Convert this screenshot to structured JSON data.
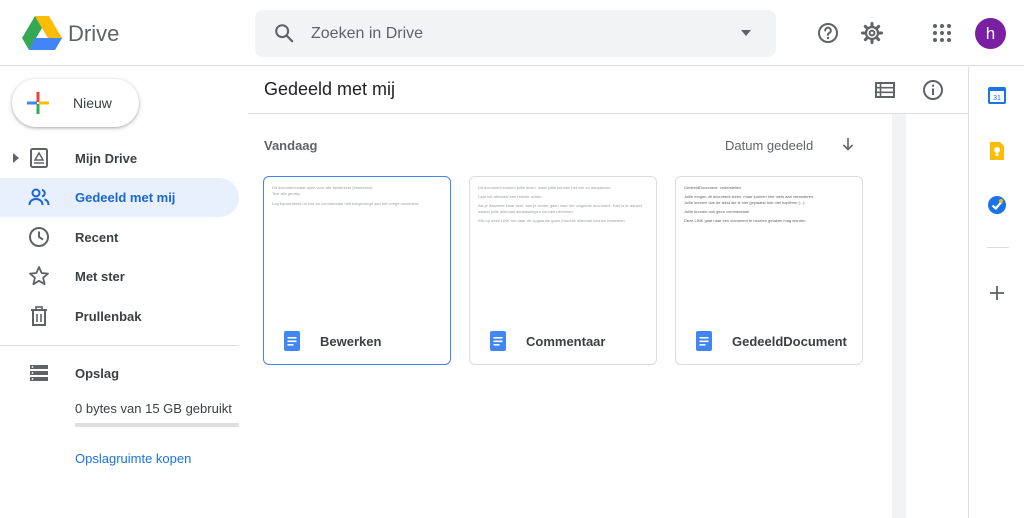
{
  "app": {
    "name": "Drive"
  },
  "search": {
    "placeholder": "Zoeken in Drive"
  },
  "header": {
    "avatar_initial": "h"
  },
  "sidebar": {
    "new_label": "Nieuw",
    "items": [
      {
        "label": "Mijn Drive",
        "icon": "drive-icon"
      },
      {
        "label": "Gedeeld met mij",
        "icon": "people-icon",
        "active": true
      },
      {
        "label": "Recent",
        "icon": "clock-icon"
      },
      {
        "label": "Met ster",
        "icon": "star-icon"
      },
      {
        "label": "Prullenbak",
        "icon": "trash-icon"
      }
    ],
    "storage": {
      "label": "Opslag",
      "used_text": "0 bytes van 15 GB gebruikt",
      "used_fraction": 0.0,
      "buy_label": "Opslagruimte kopen"
    }
  },
  "main": {
    "title": "Gedeeld met mij",
    "section": "Vandaag",
    "sort_label": "Datum gedeeld",
    "files": [
      {
        "name": "Bewerken",
        "selected": true,
        "preview": [
          "Dit document staat open voor alle bewerkers (bewerken).",
          "Test alle gevalg",
          "Log bijvoorbeeld uit hoe en commentaar helt toegevoegd aan het vorige document."
        ]
      },
      {
        "name": "Commentaar",
        "selected": false,
        "preview": [
          "Dit document kunnen jullie lezen, maar jullie kunnen het niet zo aanpassen.",
          "Laat het allemaal een reactie achter.",
          "Als je daarmee klaar bent, kan je verder gaan naar het volgende document. Dan is er aanzet waarin jullie allemaal aanpassingen kunnen uitvoeren.",
          "Klik op deze LINK om naar de opgaande gaan (bruchte allemaal kunnen bewerken."
        ]
      },
      {
        "name": "GedeeldDocument",
        "selected": false,
        "preview": [
          "GedeeldDocument: onderstellen",
          "Jullie mogen dit document lezen, maar kunnen hier niets aan veranderen.",
          "Jullie kunnen dus de tekst die ik hier geplaatst heb niet kopiëren (...)",
          "Jullie kunnen ook geen commentaar!",
          "Deze LINK gaat naar een document te beurten getaken mag worden."
        ]
      }
    ]
  },
  "colors": {
    "accent": "#1a73e8",
    "active_bg": "#e8f0fe",
    "doc_blue": "#4285f4",
    "avatar": "#7b1fa2"
  }
}
